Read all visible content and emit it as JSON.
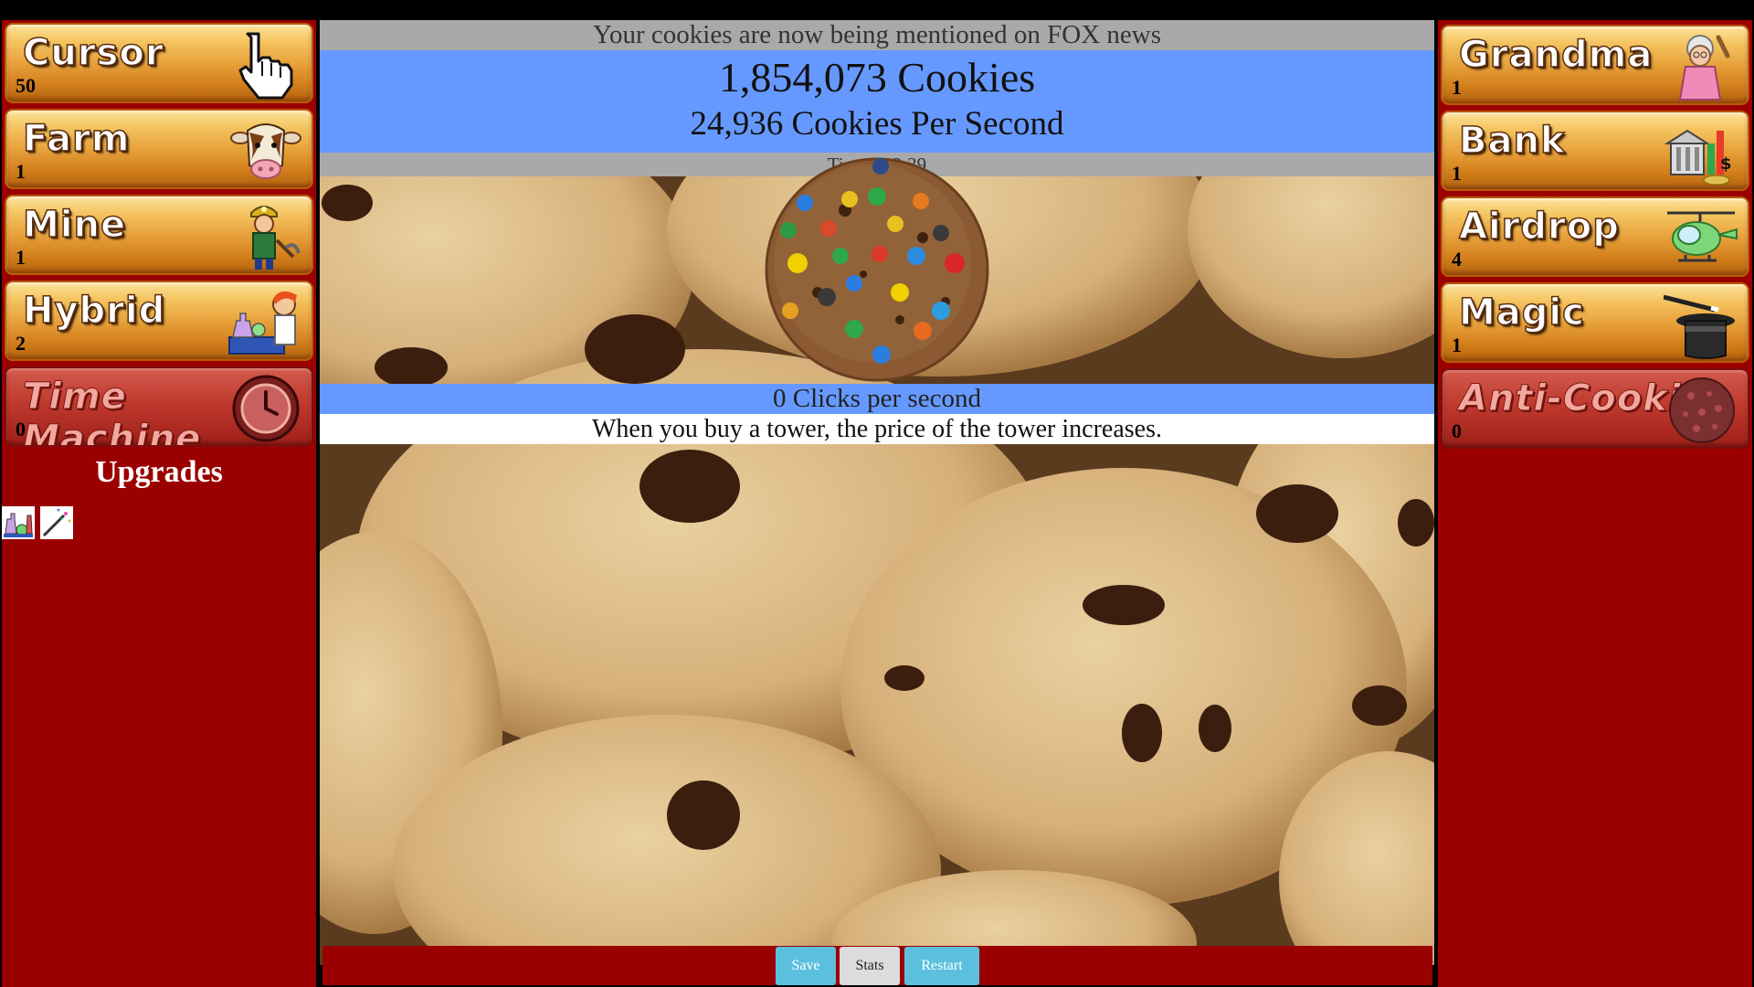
{
  "towers_left": [
    {
      "name": "Cursor",
      "count": "50",
      "icon": "cursor-icon",
      "locked": false
    },
    {
      "name": "Farm",
      "count": "1",
      "icon": "cow-icon",
      "locked": false
    },
    {
      "name": "Mine",
      "count": "1",
      "icon": "miner-icon",
      "locked": false
    },
    {
      "name": "Hybrid",
      "count": "2",
      "icon": "scientist-icon",
      "locked": false
    },
    {
      "name": "Time Machine",
      "count": "0",
      "icon": "clock-icon",
      "locked": true
    }
  ],
  "towers_right": [
    {
      "name": "Grandma",
      "count": "1",
      "icon": "grandma-icon",
      "locked": false
    },
    {
      "name": "Bank",
      "count": "1",
      "icon": "bank-icon",
      "locked": false
    },
    {
      "name": "Airdrop",
      "count": "4",
      "icon": "helicopter-icon",
      "locked": false
    },
    {
      "name": "Magic",
      "count": "1",
      "icon": "magic-hat-icon",
      "locked": false
    },
    {
      "name": "Anti-Cookie",
      "count": "0",
      "icon": "dark-cookie-icon",
      "locked": true
    }
  ],
  "upgrades": {
    "title": "Upgrades",
    "items": [
      {
        "icon": "lab-flasks-icon"
      },
      {
        "icon": "magic-wand-icon"
      }
    ]
  },
  "news": "Your cookies are now being mentioned on FOX news",
  "stats": {
    "cookies": "1,854,073 Cookies",
    "cps": "24,936 Cookies Per Second",
    "time": "Time: 0:2:39",
    "clicks": "0 Clicks per second"
  },
  "tip": "When you buy a tower, the price of the tower increases.",
  "buttons": {
    "save": "Save",
    "stats": "Stats",
    "restart": "Restart"
  },
  "colors": {
    "panel": "#9b0000",
    "band_blue": "#6699ff",
    "band_gray": "#a9a9a9",
    "button_blue": "#5bc0de",
    "button_gray": "#dcdcdc"
  }
}
